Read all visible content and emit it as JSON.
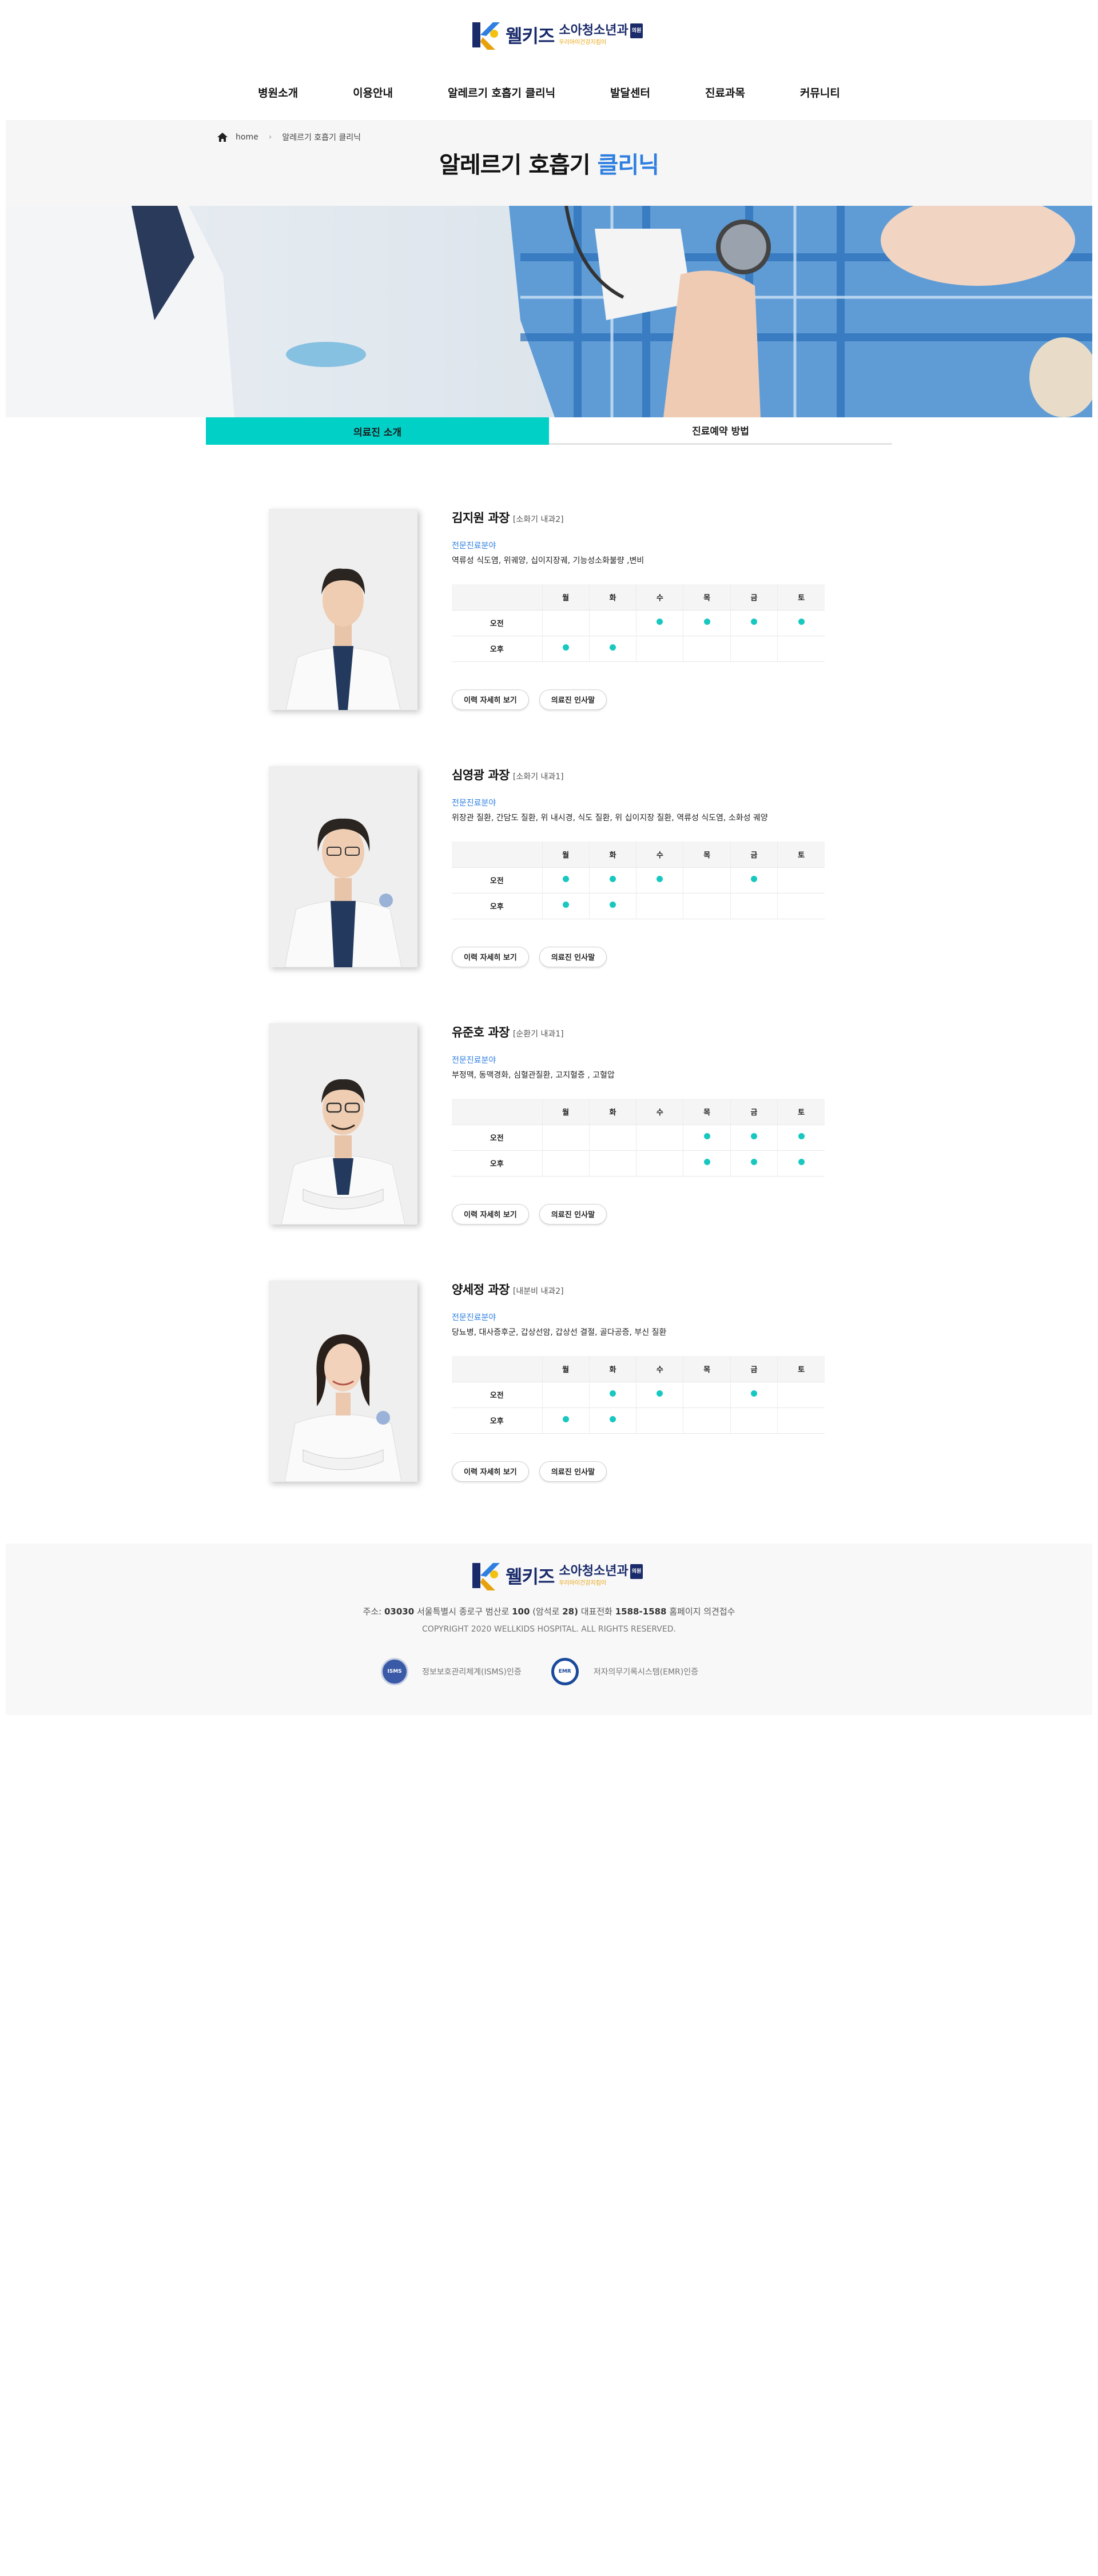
{
  "brand": {
    "main": "웰키즈",
    "sub": "소아청소년과",
    "badge": "의원",
    "tagline": "우리아이건강지킴이"
  },
  "nav": [
    "병원소개",
    "이용안내",
    "알레르기 호흡기 클리닉",
    "발달센터",
    "진료과목",
    "커뮤니티"
  ],
  "breadcrumb": {
    "home": "home",
    "current": "알레르기 호흡기 클리닉"
  },
  "page_title": {
    "main": "알레르기 호흡기",
    "accent": "클리닉"
  },
  "tabs": [
    "의료진 소개",
    "진료예약 방법"
  ],
  "schedule_header": [
    "",
    "월",
    "화",
    "수",
    "목",
    "금",
    "토"
  ],
  "spec_label": "전문진료분야",
  "buttons": {
    "history": "이력 자세히 보기",
    "greeting": "의료진 인사말"
  },
  "doctors": [
    {
      "name": "김지원 과장",
      "dept": "[소화기 내과2]",
      "spec": "역류성 식도염, 위궤양, 십이지장궤, 기능성소화불량 ,변비",
      "am_label": "오전",
      "pm_label": "오후",
      "am": [
        false,
        false,
        true,
        true,
        true,
        true
      ],
      "pm": [
        true,
        true,
        false,
        false,
        false,
        false
      ]
    },
    {
      "name": "심영광 과장",
      "dept": "[소화기 내과1]",
      "spec": "위장관 질환, 간담도 질환, 위 내시경, 식도 질환, 위 십이지장 질환, 역류성 식도염, 소화성 궤양",
      "am_label": "오전",
      "pm_label": "오후",
      "am": [
        true,
        true,
        true,
        false,
        true,
        false
      ],
      "pm": [
        true,
        true,
        false,
        false,
        false,
        false
      ]
    },
    {
      "name": "유준호 과장",
      "dept": "[순환기 내과1]",
      "spec": "부정맥, 동맥경화, 심혈관질환, 고지혈증 , 고혈압",
      "am_label": "오전",
      "pm_label": "오후",
      "am": [
        false,
        false,
        false,
        true,
        true,
        true
      ],
      "pm": [
        false,
        false,
        false,
        true,
        true,
        true
      ]
    },
    {
      "name": "양세정 과장",
      "dept": "[내분비 내과2]",
      "spec": "당뇨병, 대사증후군, 갑상선암, 갑상선 결절, 골다공증, 부신 질환",
      "am_label": "오전",
      "pm_label": "오후",
      "am": [
        false,
        true,
        true,
        false,
        true,
        false
      ],
      "pm": [
        true,
        true,
        false,
        false,
        false,
        false
      ]
    }
  ],
  "footer": {
    "addr_label": "주소:",
    "zip": "03030",
    "addr_text": "서울특별시 종로구 범산로",
    "addr_num": "100",
    "addr_extra": "(암석로",
    "addr_num2": "28)",
    "phone_label": "대표전화",
    "phone": "1588-1588",
    "reserve": "홈페이지 의견접수",
    "copyright": "COPYRIGHT 2020 WELLKIDS HOSPITAL. ALL RIGHTS RESERVED.",
    "cert1": "정보보호관리체계(ISMS)인증",
    "cert2": "저자의무기록시스템(EMR)인증"
  },
  "colors": {
    "accent_blue": "#2e7fe0",
    "teal": "#00d0c6",
    "dot": "#18c8c0",
    "navy": "#1a2b6b"
  }
}
